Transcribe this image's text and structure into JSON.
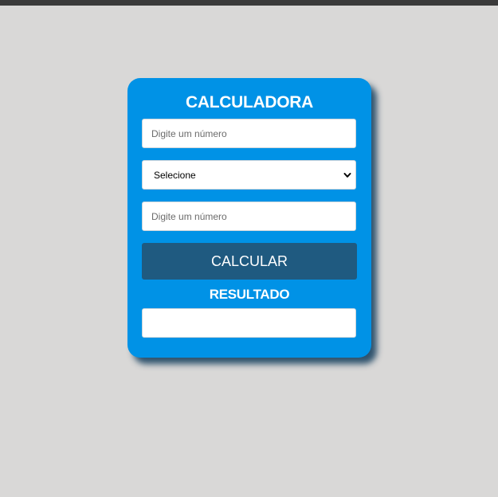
{
  "calculator": {
    "title": "CALCULADORA",
    "first_number": {
      "value": "",
      "placeholder": "Digite um número"
    },
    "operation_select": {
      "selected": "Selecione",
      "icon": "chevron-down-icon"
    },
    "second_number": {
      "value": "",
      "placeholder": "Digite um número"
    },
    "calculate_button_label": "CALCULAR",
    "result_label": "RESULTADO",
    "result_value": ""
  },
  "colors": {
    "page_background": "#d9d8d7",
    "top_bar": "#3a3a3a",
    "card_background": "#0092e6",
    "button_background": "#1f5a80",
    "text_on_card": "#ffffff"
  }
}
